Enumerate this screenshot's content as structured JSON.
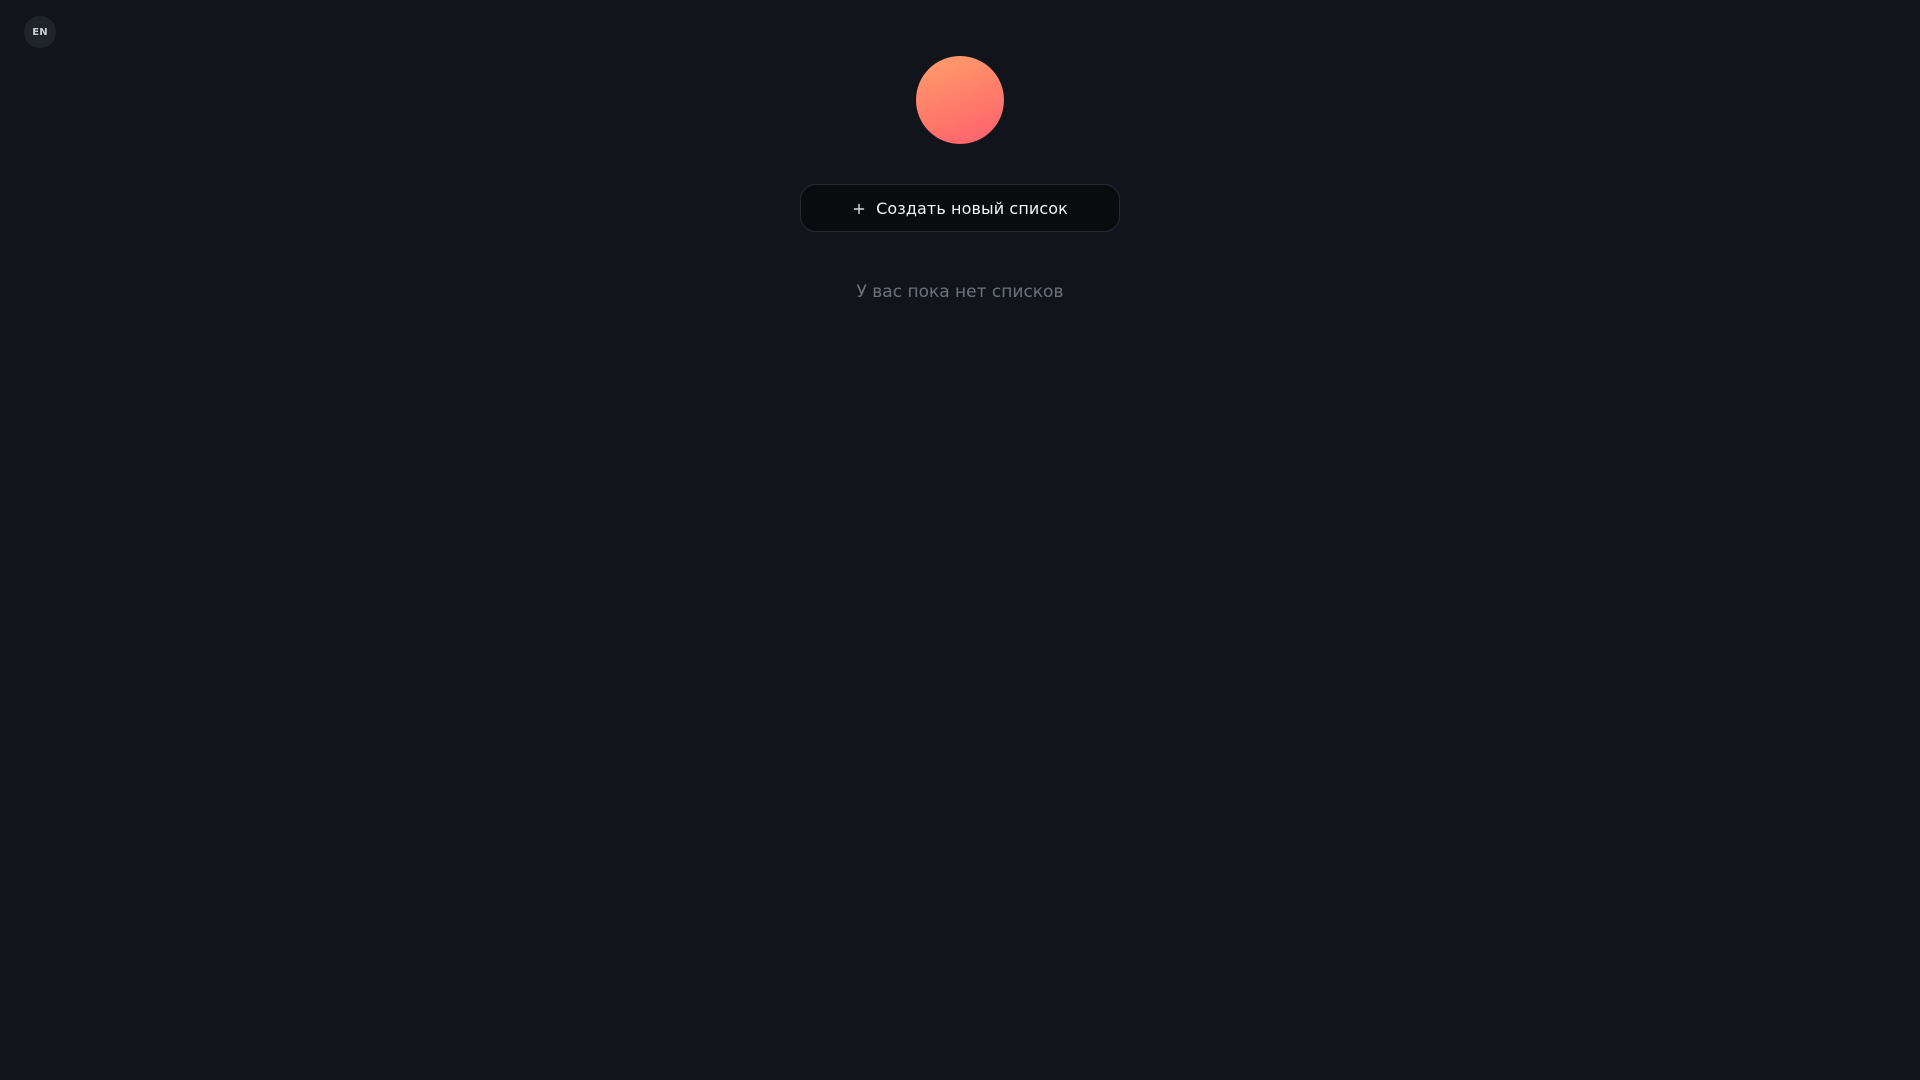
{
  "header": {
    "language_switch_label": "EN"
  },
  "profile": {
    "avatar_gradient": [
      "#ffa06a",
      "#ff5f6d"
    ]
  },
  "actions": {
    "create_list_icon": "plus-icon",
    "create_list_label": "Создать новый список"
  },
  "lists": {
    "empty_message": "У вас пока нет списков",
    "items": []
  },
  "colors": {
    "background": "#11151b",
    "button_background": "#090b0e",
    "muted_text": "#6c727c"
  }
}
